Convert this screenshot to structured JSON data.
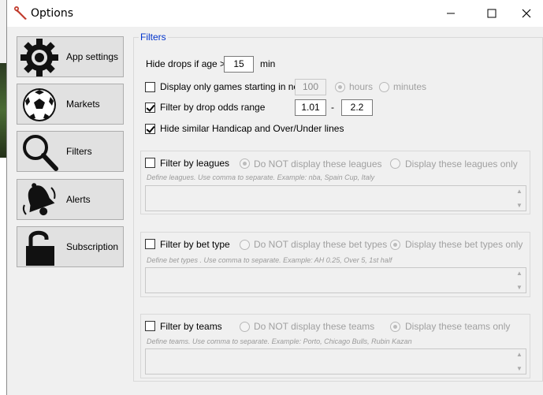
{
  "window": {
    "title": "Options"
  },
  "nav": [
    {
      "label": "App settings",
      "icon": "gear-icon"
    },
    {
      "label": "Markets",
      "icon": "soccer-ball-icon"
    },
    {
      "label": "Filters",
      "icon": "search-icon"
    },
    {
      "label": "Alerts",
      "icon": "bell-icon"
    },
    {
      "label": "Subscription",
      "icon": "lock-icon"
    }
  ],
  "filters": {
    "group_title": "Filters",
    "hide_drops": {
      "label": "Hide drops if age >",
      "value": "15",
      "unit": "min"
    },
    "display_only_games": {
      "label": "Display only games starting in next",
      "checked": false,
      "value": "100",
      "opt_hours": "hours",
      "opt_minutes": "minutes"
    },
    "drop_odds": {
      "label": "Filter by drop odds range",
      "checked": true,
      "min": "1.01",
      "sep": "-",
      "max": "2.2"
    },
    "hide_similar": {
      "label": "Hide similar Handicap and Over/Under lines",
      "checked": true
    }
  },
  "leagues": {
    "label": "Filter by leagues",
    "opt_not": "Do NOT display these leagues",
    "opt_only": "Display these leagues only",
    "selected": "opt_not",
    "hint": "Define leagues. Use comma to separate. Example: nba, Spain Cup, Italy"
  },
  "bet_type": {
    "label": "Filter by bet type",
    "opt_not": "Do NOT display these bet types",
    "opt_only": "Display these bet types only",
    "selected": "opt_only",
    "hint": "Define bet types . Use comma to separate. Example: AH 0.25, Over 5, 1st half"
  },
  "teams": {
    "label": "Filter by teams",
    "opt_not": "Do NOT display these teams",
    "opt_only": "Display these teams only",
    "selected": "opt_only",
    "hint": "Define teams. Use comma to separate. Example: Porto, Chicago Bulls, Rubin Kazan"
  }
}
